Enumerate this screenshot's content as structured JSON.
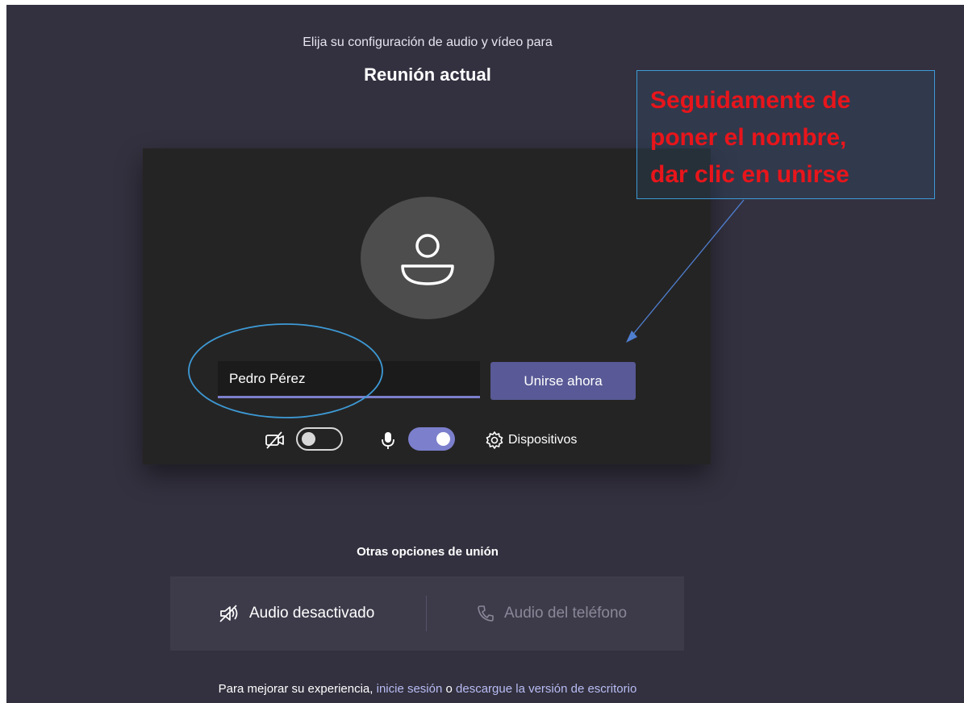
{
  "header": {
    "subtitle": "Elija su configuración de audio y vídeo para",
    "meeting_title": "Reunión actual"
  },
  "prejoin": {
    "name_value": "Pedro Pérez",
    "join_label": "Unirse ahora",
    "devices_label": "Dispositivos",
    "camera_enabled": false,
    "mic_enabled": true
  },
  "annotation": {
    "lines": [
      "Seguidamente de",
      "poner el nombre,",
      "dar clic en unirse"
    ]
  },
  "other_options": {
    "title": "Otras opciones de unión",
    "audio_off_label": "Audio desactivado",
    "phone_audio_label": "Audio del teléfono"
  },
  "footer": {
    "prefix": "Para mejorar su experiencia, ",
    "signin_link": "inicie sesión",
    "middle": " o ",
    "download_link": "descargue la versión de escritorio"
  },
  "colors": {
    "background": "#33313f",
    "accent": "#585996",
    "annotation_text": "#e8151b",
    "annotation_border": "#3d9ad6"
  }
}
